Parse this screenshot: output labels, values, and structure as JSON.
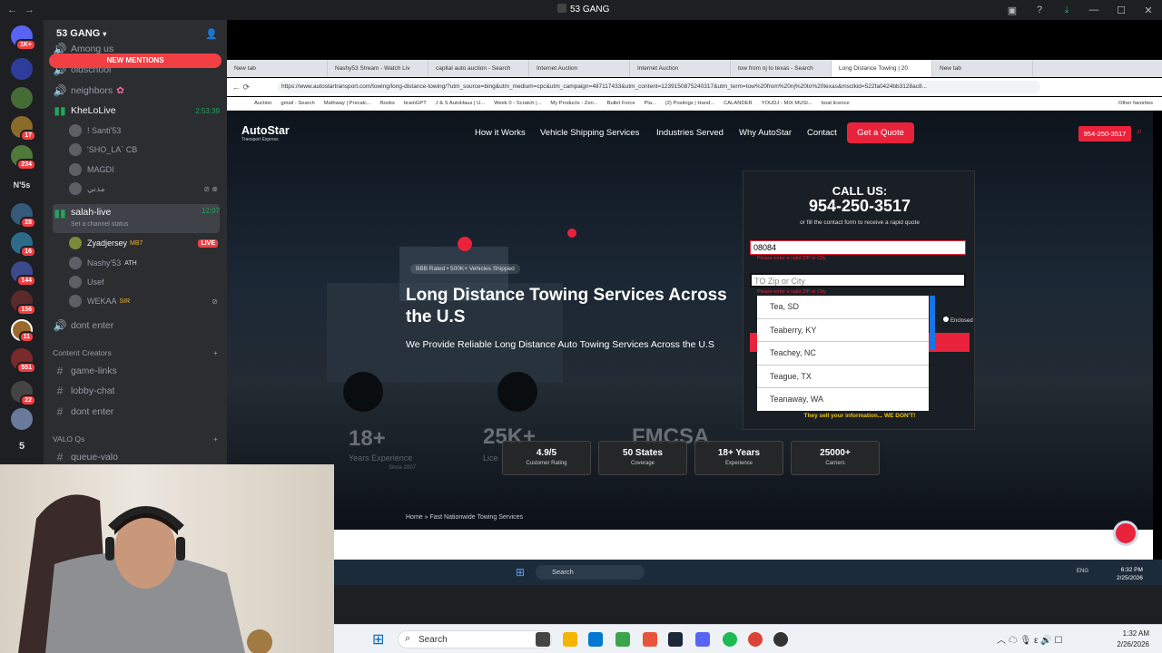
{
  "discord": {
    "title": "53 GANG",
    "server_name": "53 GANG",
    "new_mentions": "NEW MENTIONS",
    "channels": {
      "among_us": "Among us",
      "oldschool": "oldschool",
      "neighbors": "neighbors",
      "kheloulive": "KheLoLive",
      "kheloulive_time": "2:53:39",
      "salah_live": "salah-live",
      "salah_live_time": "12:07",
      "salah_status": "Set a channel status",
      "dont_enter": "dont enter",
      "content_creators": "Content Creators",
      "game_links": "game-links",
      "lobby_chat": "lobby-chat",
      "dont_enter_2": "dont enter",
      "valo_qs": "VALO Qs",
      "queue_valo": "queue-valo"
    },
    "voice_users_1": [
      "! Santi'53",
      "'SHO_LA` CB",
      "MAGDI",
      "مدني"
    ],
    "voice_users_2": [
      {
        "name": "Zyadjersey",
        "tag": "MB7",
        "live": "LIVE"
      },
      {
        "name": "Nashy'53",
        "tag": "ATH"
      },
      {
        "name": "Usef",
        "tag": ""
      },
      {
        "name": "WEKAA",
        "tag": "SIR"
      }
    ],
    "server_badges": [
      "1K+",
      "17",
      "234",
      "28",
      "16",
      "144",
      "156",
      "11",
      "551",
      "22"
    ],
    "server_label_ns": "N'5s",
    "server_label_5": "5"
  },
  "browser": {
    "tabs": [
      "New tab",
      "Nashy53 Stream - Watch Liv",
      "capital auto auction - Search",
      "Internet Auction",
      "Internet Auction",
      "tow from nj to texas - Search",
      "Long Distance Towing | 20",
      "New tab"
    ],
    "url": "https://www.autostartransport.com/towing/long-distance-towing/?utm_source=bing&utm_medium=cpc&utm_campaign=487117433&utm_content=1239150875240317&utm_term=tow%20from%20nj%20to%20texas&msclkid=522fa0424bb3128ac8...",
    "bookmarks": [
      "Auction",
      "gmail - Search",
      "Mathway | Precalc...",
      "Books",
      "brainGPT",
      "J & S AutoHaus | U...",
      "Week 0 - Scratch |...",
      "My Products - Zen...",
      "Bullet Force",
      "Pla...",
      "(2) Postings | Hand...",
      "CALANDER",
      "YOUDJ - MIX MUSI...",
      "boat licence",
      "Other favorites"
    ]
  },
  "site": {
    "logo": "AutoStar",
    "logo_sub": "Transport Express",
    "nav": [
      "How it Works",
      "Vehicle Shipping Services",
      "Industries Served",
      "Why AutoStar",
      "Contact"
    ],
    "quote_btn": "Get a Quote",
    "phone_btn": "954-250-3517",
    "rated": "BBB Rated • 500K+ Vehicles Shipped",
    "headline": "Long Distance Towing Services Across the U.S",
    "subhead": "We Provide Reliable Long Distance Auto Towing Services Across the U.S",
    "stats": [
      {
        "value": "4.9/5",
        "label": "Customer Rating"
      },
      {
        "value": "50 States",
        "label": "Coverage"
      },
      {
        "value": "18+ Years",
        "label": "Experience"
      },
      {
        "value": "25000+",
        "label": "Carriers"
      }
    ],
    "faint": {
      "years": "18+",
      "years_label": "Years Experience",
      "since": "Since 2007",
      "k": "25K+",
      "lic": "Lice",
      "fmcsa": "FMCSA"
    },
    "breadcrumb": "Home » Fast Nationwide Towing Services"
  },
  "form": {
    "call_us": "CALL US:",
    "phone": "954-250-3517",
    "or_fill": "or fill the contact form to receive a rapid quote",
    "from_value": "08084",
    "from_error": "Please enter a valid ZIP or City",
    "to_placeholder": "TO Zip or City",
    "to_error": "Please enter a valid ZIP or City",
    "enclosed": "Enclosed",
    "suggestions": [
      "Tea, SD",
      "Teaberry, KY",
      "Teachey, NC",
      "Teague, TX",
      "Teanaway, WA"
    ],
    "privacy": "They sell your information... WE DON'T!"
  },
  "inner_taskbar": {
    "search": "Search",
    "lang": "ENG",
    "time": "6:32 PM",
    "date": "2/25/2026"
  },
  "taskbar": {
    "search": "Search",
    "time": "1:32 AM",
    "date": "2/26/2026"
  }
}
